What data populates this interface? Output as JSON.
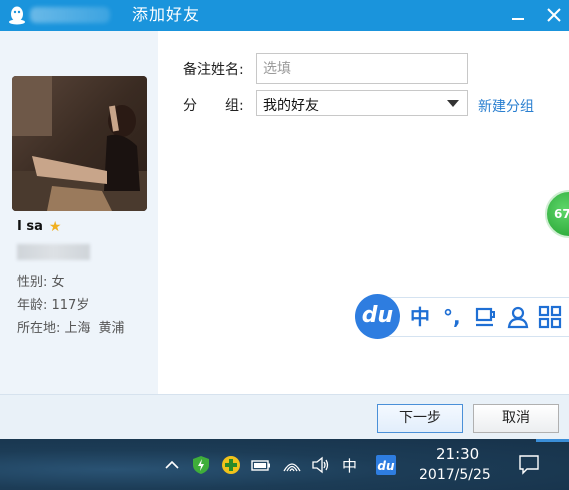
{
  "window": {
    "title": "添加好友"
  },
  "profile": {
    "nickname": "I sa",
    "gender_label": "性别: ",
    "gender": "女",
    "age_label": "年龄: ",
    "age": "117岁",
    "location_label": "所在地: ",
    "location_province": "上海",
    "location_city": "黄浦"
  },
  "form": {
    "remark_label": "备注姓名:",
    "remark_value": "",
    "remark_placeholder": "选填",
    "group_label_1": "分",
    "group_label_2": "组:",
    "group_value": "我的好友",
    "new_group_link": "新建分组"
  },
  "floating_ball": {
    "value": "67"
  },
  "ime_toolbar": {
    "logo": "du",
    "language": "中",
    "punct": "°,",
    "icons": [
      "cup-icon",
      "user-icon",
      "grid-icon"
    ]
  },
  "footer": {
    "next_label": "下一步",
    "cancel_label": "取消"
  },
  "taskbar": {
    "ime_indicator": "中",
    "time": "21:30",
    "date": "2017/5/25"
  },
  "colors": {
    "titlebar": "#1a94dc",
    "link": "#2a7fd0",
    "ime_blue": "#2e7de0",
    "taskbar": "#1c3c56"
  }
}
